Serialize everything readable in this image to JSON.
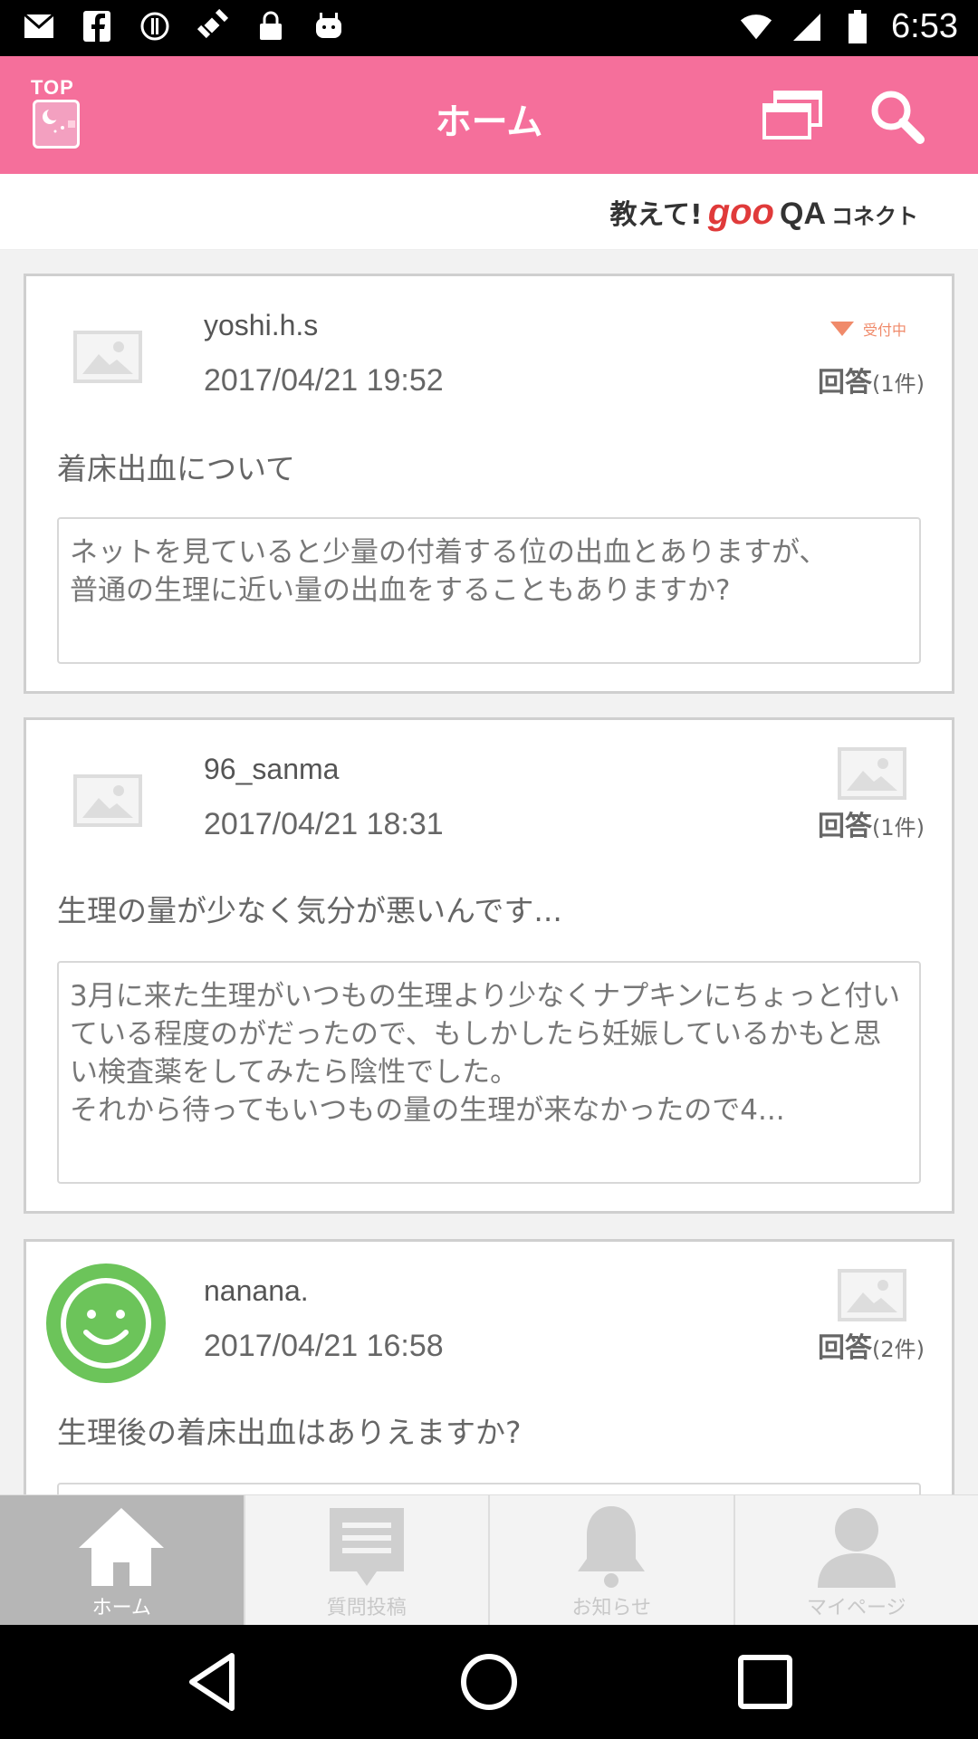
{
  "status_bar": {
    "time": "6:53",
    "icons": [
      "mail-icon",
      "facebook-icon",
      "alert-circle-icon",
      "fake-gps-icon",
      "lock-icon",
      "android-icon",
      "wifi-icon",
      "signal-icon",
      "battery-icon"
    ]
  },
  "header": {
    "top_label": "TOP",
    "title": "ホーム",
    "icons": [
      "windows-icon",
      "search-icon"
    ]
  },
  "brand": {
    "oshiete": "教えて!",
    "goo": "goo",
    "qa": "QA",
    "connect": "コネクト"
  },
  "questions": [
    {
      "username": "yoshi.h.s",
      "date": "2017/04/21 19:52",
      "status": "受付中",
      "answer_label": "回答",
      "answer_count": "(1件)",
      "title": "着床出血について",
      "body": "ネットを見ていると少量の付着する位の出血とありますが、\n普通の生理に近い量の出血をすることもありますか?"
    },
    {
      "username": "96_sanma",
      "date": "2017/04/21 18:31",
      "answer_label": "回答",
      "answer_count": "(1件)",
      "title": "生理の量が少なく気分が悪いんです...",
      "body": "3月に来た生理がいつもの生理より少なくナプキンにちょっと付いている程度のがだったので、もしかしたら妊娠しているかもと思い検査薬をしてみたら陰性でした。\nそれから待ってもいつもの量の生理が来なかったので4..."
    },
    {
      "username": "nanana.",
      "date": "2017/04/21 16:58",
      "answer_label": "回答",
      "answer_count": "(2件)",
      "title": "生理後の着床出血はありえますか?",
      "body": ""
    }
  ],
  "bottom_nav": {
    "items": [
      {
        "label": "ホーム",
        "icon": "home-icon",
        "active": true
      },
      {
        "label": "質問投稿",
        "icon": "post-question-icon",
        "active": false
      },
      {
        "label": "お知らせ",
        "icon": "bell-icon",
        "active": false
      },
      {
        "label": "マイページ",
        "icon": "person-icon",
        "active": false
      }
    ]
  },
  "colors": {
    "header": "#f56f9b",
    "status_accent": "#f08a6a",
    "avatar_green": "#6cc45a",
    "nav_active": "#b6b6b6"
  }
}
